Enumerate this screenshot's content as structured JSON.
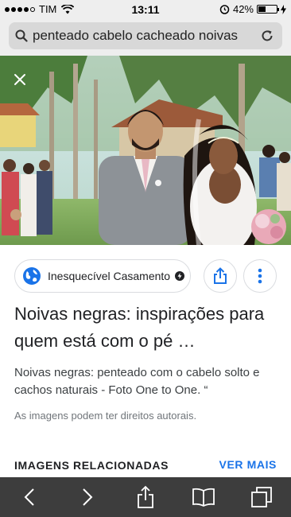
{
  "status_bar": {
    "carrier": "TIM",
    "time": "13:11",
    "battery_percent": "42%",
    "battery_level": 0.42,
    "icons": [
      "signal-dots-icon",
      "wifi-icon",
      "alarm-icon",
      "battery-icon",
      "charging-icon"
    ]
  },
  "url_bar": {
    "text": "penteado cabelo cacheado noivas",
    "icons": [
      "search-icon",
      "reload-icon"
    ]
  },
  "hero": {
    "icons": [
      "close-icon"
    ]
  },
  "source": {
    "name": "Inesquecível Casamento",
    "icons": [
      "globe-icon",
      "verified-icon",
      "share-icon",
      "more-vert-icon"
    ]
  },
  "result": {
    "title": "Noivas negras: inspirações para quem está com o pé …",
    "description": "Noivas negras: penteado com o cabelo solto e cachos naturais - Foto One to One. “",
    "rights_notice": "As imagens podem ter direitos autorais."
  },
  "related": {
    "heading": "IMAGENS RELACIONADAS",
    "see_more": "VER MAIS"
  },
  "toolbar": {
    "icons": [
      "back-icon",
      "forward-icon",
      "share-icon",
      "bookmarks-icon",
      "tabs-icon"
    ]
  },
  "colors": {
    "link_blue": "#1a73e8",
    "toolbar_bg": "#3d3d3d",
    "globe_blue": "#1a73e8"
  }
}
